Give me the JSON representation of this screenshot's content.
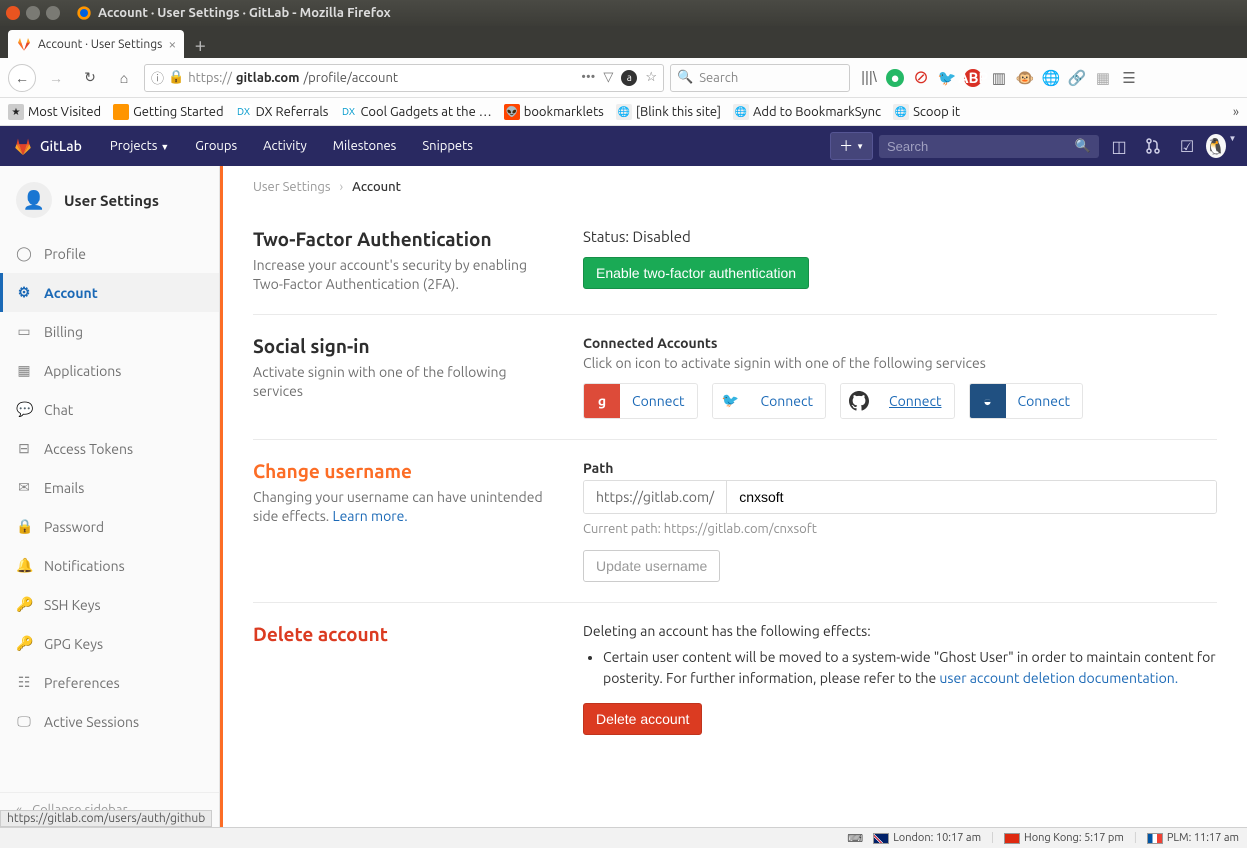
{
  "window": {
    "title": "Account · User Settings · GitLab - Mozilla Firefox"
  },
  "tab": {
    "title": "Account · User Settings"
  },
  "browser": {
    "url_prefix": "https://",
    "url_domain": "gitlab.com",
    "url_path": "/profile/account",
    "search_placeholder": "Search",
    "bookmarks": [
      {
        "label": "Most Visited"
      },
      {
        "label": "Getting Started"
      },
      {
        "label": "DX Referrals"
      },
      {
        "label": "Cool Gadgets at the …"
      },
      {
        "label": "bookmarklets"
      },
      {
        "label": "[Blink this site]"
      },
      {
        "label": "Add to BookmarkSync"
      },
      {
        "label": "Scoop it"
      }
    ],
    "status_hover": "https://gitlab.com/users/auth/github"
  },
  "gitlab_nav": {
    "brand": "GitLab",
    "items": [
      "Projects",
      "Groups",
      "Activity",
      "Milestones",
      "Snippets"
    ],
    "search_placeholder": "Search"
  },
  "sidebar": {
    "header": "User Settings",
    "items": [
      {
        "label": "Profile"
      },
      {
        "label": "Account"
      },
      {
        "label": "Billing"
      },
      {
        "label": "Applications"
      },
      {
        "label": "Chat"
      },
      {
        "label": "Access Tokens"
      },
      {
        "label": "Emails"
      },
      {
        "label": "Password"
      },
      {
        "label": "Notifications"
      },
      {
        "label": "SSH Keys"
      },
      {
        "label": "GPG Keys"
      },
      {
        "label": "Preferences"
      },
      {
        "label": "Active Sessions"
      }
    ],
    "collapse": "Collapse sidebar"
  },
  "breadcrumb": {
    "root": "User Settings",
    "current": "Account"
  },
  "twofa": {
    "title": "Two-Factor Authentication",
    "desc": "Increase your account's security by enabling Two-Factor Authentication (2FA).",
    "status": "Status: Disabled",
    "button": "Enable two-factor authentication"
  },
  "social": {
    "title": "Social sign-in",
    "desc": "Activate signin with one of the following services",
    "subhead": "Connected Accounts",
    "subdesc": "Click on icon to activate signin with one of the following services",
    "connect": "Connect"
  },
  "username": {
    "title": "Change username",
    "desc_a": "Changing your username can have unintended side effects. ",
    "desc_link": "Learn more.",
    "path_label": "Path",
    "prefix": "https://gitlab.com/",
    "value": "cnxsoft",
    "current": "Current path: https://gitlab.com/cnxsoft",
    "button": "Update username"
  },
  "delete": {
    "title": "Delete account",
    "desc": "Deleting an account has the following effects:",
    "bullet_a": "Certain user content will be moved to a system-wide \"Ghost User\" in order to maintain content for posterity. For further information, please refer to the ",
    "bullet_link": "user account deletion documentation.",
    "button": "Delete account"
  },
  "taskbar": {
    "tz1": "London: 10:17 am",
    "tz2": "Hong Kong: 5:17 pm",
    "tz3": "PLM: 11:17 am"
  }
}
